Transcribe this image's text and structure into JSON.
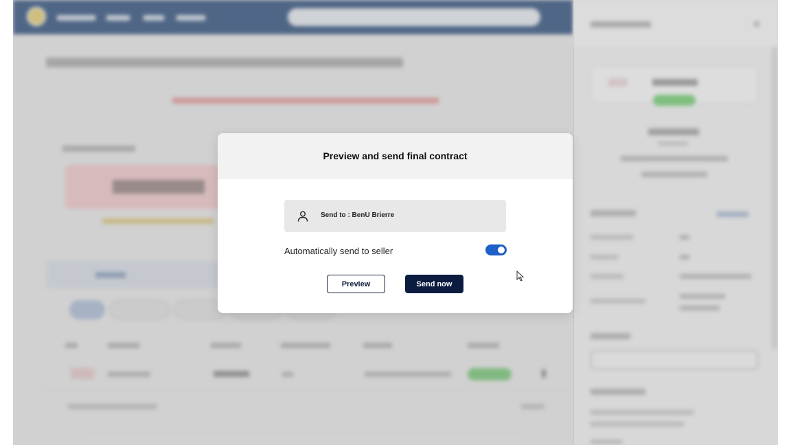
{
  "modal": {
    "title": "Preview and send final contract",
    "send_to_label": "Send to : BenU Brierre",
    "auto_send_label": "Automatically send to seller",
    "auto_send_enabled": true,
    "preview_button": "Preview",
    "send_button": "Send now"
  },
  "colors": {
    "primary_dark": "#0c1c40",
    "toggle_on": "#1f5fc8",
    "header_bar": "#4e6a90"
  },
  "icons": {
    "recipient": "person-icon",
    "cursor": "mouse-pointer-icon"
  }
}
